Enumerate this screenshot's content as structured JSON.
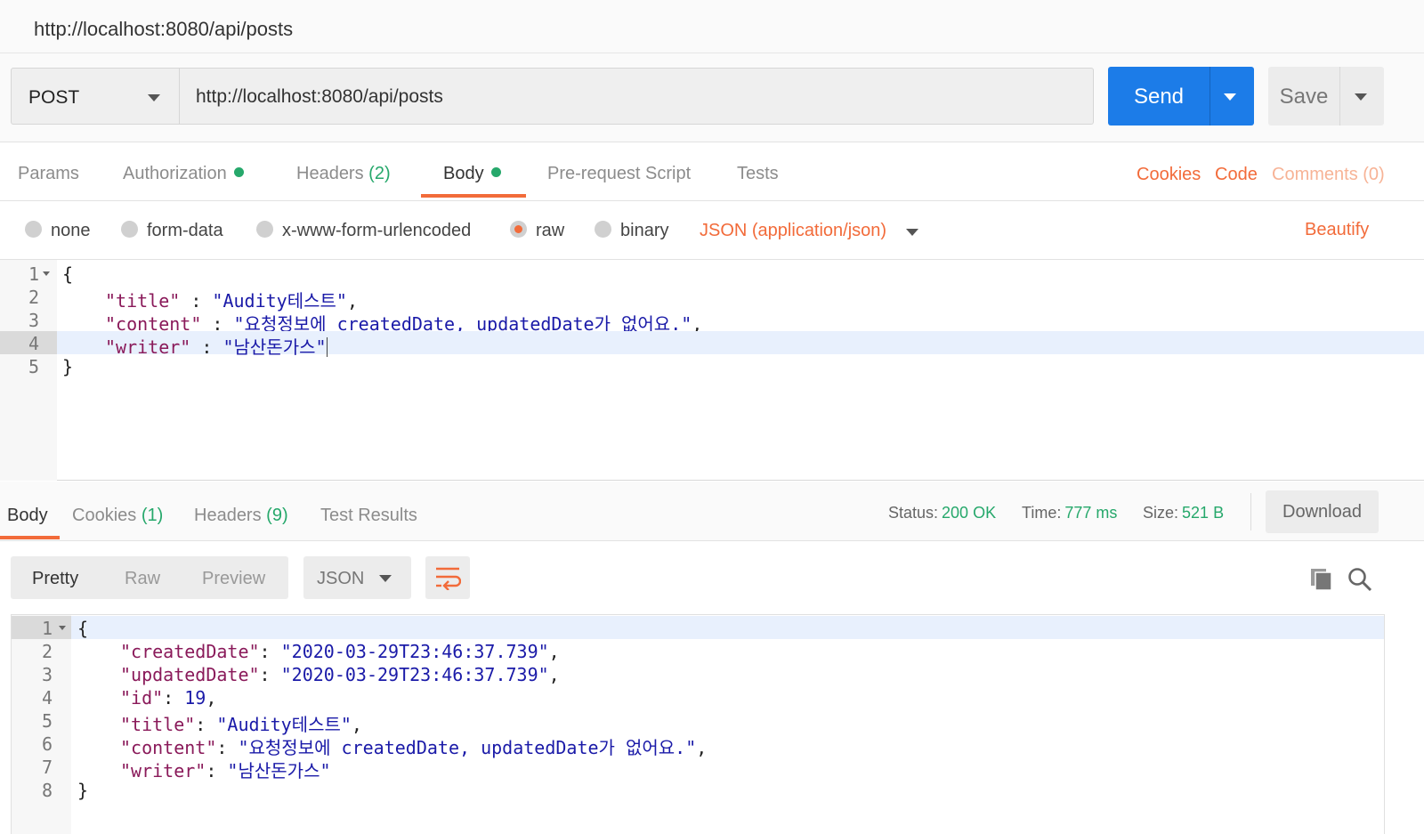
{
  "window": {
    "title": "http://localhost:8080/api/posts"
  },
  "request": {
    "method": "POST",
    "url": "http://localhost:8080/api/posts",
    "send_label": "Send",
    "save_label": "Save"
  },
  "req_tabs": {
    "params": "Params",
    "authorization": "Authorization",
    "headers": "Headers",
    "headers_count": "(2)",
    "body": "Body",
    "prerequest": "Pre-request Script",
    "tests": "Tests",
    "cookies": "Cookies",
    "code": "Code",
    "comments": "Comments (0)"
  },
  "body_options": {
    "none": "none",
    "form_data": "form-data",
    "urlencoded": "x-www-form-urlencoded",
    "raw": "raw",
    "binary": "binary",
    "selected": "raw",
    "content_type": "JSON (application/json)",
    "beautify": "Beautify"
  },
  "request_body": {
    "line_numbers": [
      "1",
      "2",
      "3",
      "4",
      "5"
    ],
    "open_brace": "{",
    "close_brace": "}",
    "title_key": "\"title\"",
    "title_value": "\"Audity테스트\"",
    "content_key": "\"content\"",
    "content_value": "\"요청정보에 createdDate, updatedDate가 없어요.\"",
    "writer_key": "\"writer\"",
    "writer_value": "\"남산돈가스\"",
    "colon_spaced": " : ",
    "comma": ","
  },
  "response": {
    "tabs": {
      "body": "Body",
      "cookies": "Cookies",
      "cookies_count": "(1)",
      "headers": "Headers",
      "headers_count": "(9)",
      "test_results": "Test Results"
    },
    "status_label": "Status:",
    "status_value": "200 OK",
    "time_label": "Time:",
    "time_value": "777 ms",
    "size_label": "Size:",
    "size_value": "521 B",
    "download": "Download",
    "view_modes": [
      "Pretty",
      "Raw",
      "Preview"
    ],
    "active_view": "Pretty",
    "format": "JSON",
    "body": {
      "line_numbers": [
        "1",
        "2",
        "3",
        "4",
        "5",
        "6",
        "7",
        "8"
      ],
      "open_brace": "{",
      "close_brace": "}",
      "created_key": "\"createdDate\"",
      "created_value": "\"2020-03-29T23:46:37.739\"",
      "updated_key": "\"updatedDate\"",
      "updated_value": "\"2020-03-29T23:46:37.739\"",
      "id_key": "\"id\"",
      "id_value": "19",
      "title_key": "\"title\"",
      "title_value": "\"Audity테스트\"",
      "content_key": "\"content\"",
      "content_value": "\"요청정보에 createdDate, updatedDate가 없어요.\"",
      "writer_key": "\"writer\"",
      "writer_value": "\"남산돈가스\"",
      "colon": ": ",
      "comma": ","
    }
  },
  "colors": {
    "accent": "#f26b3a",
    "send": "#1c7ce8",
    "success": "#26a86b",
    "json_key": "#8a1a5a",
    "json_string": "#1a1aa8"
  },
  "icons": [
    "chevron-down-icon",
    "wrap-lines-icon",
    "copy-icon",
    "search-icon",
    "fold-arrow-icon"
  ]
}
